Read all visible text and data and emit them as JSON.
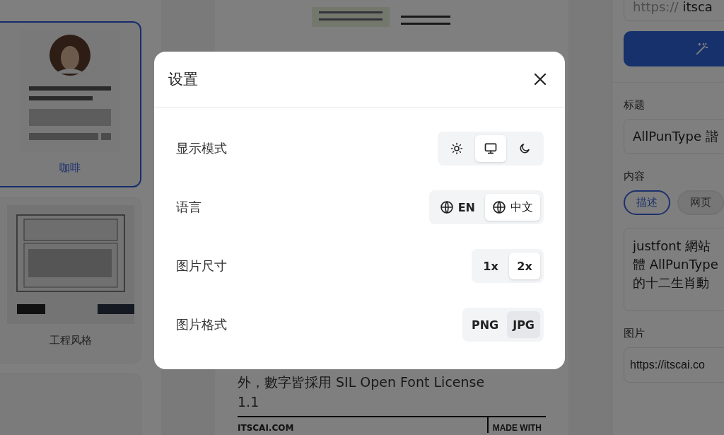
{
  "sidebar": {
    "templates": [
      {
        "label": "咖啡",
        "selected": true
      },
      {
        "label": "工程风格",
        "selected": false
      }
    ]
  },
  "preview": {
    "body_lines": [
      "外，數字皆採用 SIL Open Font License",
      "1.1"
    ],
    "footer_site": "ITSCAI.COM",
    "footer_badge": "MADE WITH"
  },
  "editor": {
    "url_prefix": "https://",
    "url_value": "itsca",
    "title_label": "标题",
    "title_value": "AllPunType 諧",
    "content_label": "内容",
    "content_tabs": [
      {
        "label": "描述",
        "selected": true
      },
      {
        "label": "网页",
        "selected": false
      }
    ],
    "content_lines": [
      "justfont 網站",
      "體 AllPunType",
      "的十二生肖動"
    ],
    "image_label": "图片",
    "image_value": "https://itscai.co"
  },
  "dialog": {
    "title": "设置",
    "rows": [
      {
        "label": "显示模式",
        "kind": "theme",
        "options": [
          {
            "selected": false
          },
          {
            "selected": true
          },
          {
            "selected": false
          }
        ]
      },
      {
        "label": "语言",
        "kind": "language",
        "options": [
          {
            "label": "EN",
            "selected": false
          },
          {
            "label": "中文",
            "selected": true
          }
        ]
      },
      {
        "label": "图片尺寸",
        "kind": "plain",
        "options": [
          {
            "label": "1x",
            "selected": false
          },
          {
            "label": "2x",
            "selected": true
          }
        ]
      },
      {
        "label": "图片格式",
        "kind": "plain",
        "options": [
          {
            "label": "PNG",
            "selected": false,
            "highlighted": false
          },
          {
            "label": "JPG",
            "selected": false,
            "highlighted": true
          }
        ]
      }
    ]
  }
}
